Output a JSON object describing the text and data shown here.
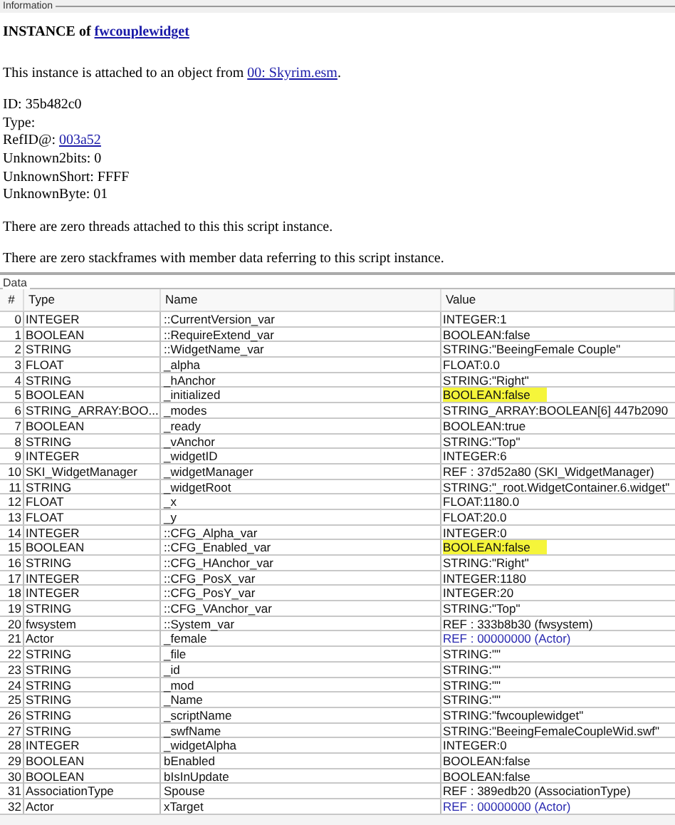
{
  "info_group": {
    "label": "Information",
    "heading_prefix": "INSTANCE of",
    "heading_link": "fwcouplewidget",
    "attached_text": "This instance is attached to an object from",
    "attached_link": "00: Skyrim.esm",
    "attached_suffix": ".",
    "fields": [
      {
        "label": "ID:",
        "value": "35b482c0"
      },
      {
        "label": "Type:"
      },
      {
        "label": "RefID@:",
        "link": "003a52"
      },
      {
        "label": "Unknown2bits:",
        "value": "0"
      },
      {
        "label": "UnknownShort:",
        "value": "FFFF"
      },
      {
        "label": "UnknownByte:",
        "value": "01"
      }
    ],
    "notes": [
      "There are zero threads attached to this this script instance.",
      "There are zero stackframes with member data referring to this script instance."
    ]
  },
  "data_group": {
    "label": "Data",
    "columns": [
      "#",
      "Type",
      "Name",
      "Value"
    ],
    "rows": [
      {
        "index": "0",
        "type": "INTEGER",
        "name": "::CurrentVersion_var",
        "value": "INTEGER:1",
        "highlighted": false,
        "kind": "plain"
      },
      {
        "index": "1",
        "type": "BOOLEAN",
        "name": "::RequireExtend_var",
        "value": "BOOLEAN:false",
        "highlighted": false,
        "kind": "plain"
      },
      {
        "index": "2",
        "type": "STRING",
        "name": "::WidgetName_var",
        "value": "STRING:\"BeeingFemale Couple\"",
        "highlighted": false,
        "kind": "plain"
      },
      {
        "index": "3",
        "type": "FLOAT",
        "name": "_alpha",
        "value": "FLOAT:0.0",
        "highlighted": false,
        "kind": "plain"
      },
      {
        "index": "4",
        "type": "STRING",
        "name": "_hAnchor",
        "value": "STRING:\"Right\"",
        "highlighted": false,
        "kind": "plain"
      },
      {
        "index": "5",
        "type": "BOOLEAN",
        "name": "_initialized",
        "value": "BOOLEAN:false",
        "highlighted": true,
        "kind": "plain"
      },
      {
        "index": "6",
        "type": "STRING_ARRAY:BOO...",
        "name": "_modes",
        "value": "STRING_ARRAY:BOOLEAN[6] 447b2090",
        "highlighted": false,
        "kind": "plain"
      },
      {
        "index": "7",
        "type": "BOOLEAN",
        "name": "_ready",
        "value": "BOOLEAN:true",
        "highlighted": false,
        "kind": "plain"
      },
      {
        "index": "8",
        "type": "STRING",
        "name": "_vAnchor",
        "value": "STRING:\"Top\"",
        "highlighted": false,
        "kind": "plain"
      },
      {
        "index": "9",
        "type": "INTEGER",
        "name": "_widgetID",
        "value": "INTEGER:6",
        "highlighted": false,
        "kind": "plain"
      },
      {
        "index": "10",
        "type": "SKI_WidgetManager",
        "name": "_widgetManager",
        "value": "REF : 37d52a80 (SKI_WidgetManager)",
        "highlighted": false,
        "kind": "plain"
      },
      {
        "index": "11",
        "type": "STRING",
        "name": "_widgetRoot",
        "value": "STRING:\"_root.WidgetContainer.6.widget\"",
        "highlighted": false,
        "kind": "plain"
      },
      {
        "index": "12",
        "type": "FLOAT",
        "name": "_x",
        "value": "FLOAT:1180.0",
        "highlighted": false,
        "kind": "plain"
      },
      {
        "index": "13",
        "type": "FLOAT",
        "name": "_y",
        "value": "FLOAT:20.0",
        "highlighted": false,
        "kind": "plain"
      },
      {
        "index": "14",
        "type": "INTEGER",
        "name": "::CFG_Alpha_var",
        "value": "INTEGER:0",
        "highlighted": false,
        "kind": "plain"
      },
      {
        "index": "15",
        "type": "BOOLEAN",
        "name": "::CFG_Enabled_var",
        "value": "BOOLEAN:false",
        "highlighted": true,
        "kind": "plain"
      },
      {
        "index": "16",
        "type": "STRING",
        "name": "::CFG_HAnchor_var",
        "value": "STRING:\"Right\"",
        "highlighted": false,
        "kind": "plain"
      },
      {
        "index": "17",
        "type": "INTEGER",
        "name": "::CFG_PosX_var",
        "value": "INTEGER:1180",
        "highlighted": false,
        "kind": "plain"
      },
      {
        "index": "18",
        "type": "INTEGER",
        "name": "::CFG_PosY_var",
        "value": "INTEGER:20",
        "highlighted": false,
        "kind": "plain"
      },
      {
        "index": "19",
        "type": "STRING",
        "name": "::CFG_VAnchor_var",
        "value": "STRING:\"Top\"",
        "highlighted": false,
        "kind": "plain"
      },
      {
        "index": "20",
        "type": "fwsystem",
        "name": "::System_var",
        "value": "REF : 333b8b30 (fwsystem)",
        "highlighted": false,
        "kind": "plain"
      },
      {
        "index": "21",
        "type": "Actor",
        "name": "_female",
        "value": "REF : 00000000 (Actor)",
        "highlighted": false,
        "kind": "null_ref"
      },
      {
        "index": "22",
        "type": "STRING",
        "name": "_file",
        "value": "STRING:\"\"",
        "highlighted": false,
        "kind": "plain"
      },
      {
        "index": "23",
        "type": "STRING",
        "name": "_id",
        "value": "STRING:\"\"",
        "highlighted": false,
        "kind": "plain"
      },
      {
        "index": "24",
        "type": "STRING",
        "name": "_mod",
        "value": "STRING:\"\"",
        "highlighted": false,
        "kind": "plain"
      },
      {
        "index": "25",
        "type": "STRING",
        "name": "_Name",
        "value": "STRING:\"\"",
        "highlighted": false,
        "kind": "plain"
      },
      {
        "index": "26",
        "type": "STRING",
        "name": "_scriptName",
        "value": "STRING:\"fwcouplewidget\"",
        "highlighted": false,
        "kind": "plain"
      },
      {
        "index": "27",
        "type": "STRING",
        "name": "_swfName",
        "value": "STRING:\"BeeingFemaleCoupleWid.swf\"",
        "highlighted": false,
        "kind": "plain"
      },
      {
        "index": "28",
        "type": "INTEGER",
        "name": "_widgetAlpha",
        "value": "INTEGER:0",
        "highlighted": false,
        "kind": "plain"
      },
      {
        "index": "29",
        "type": "BOOLEAN",
        "name": "bEnabled",
        "value": "BOOLEAN:false",
        "highlighted": false,
        "kind": "plain"
      },
      {
        "index": "30",
        "type": "BOOLEAN",
        "name": "bIsInUpdate",
        "value": "BOOLEAN:false",
        "highlighted": false,
        "kind": "plain"
      },
      {
        "index": "31",
        "type": "AssociationType",
        "name": "Spouse",
        "value": "REF : 389edb20 (AssociationType)",
        "highlighted": false,
        "kind": "plain"
      },
      {
        "index": "32",
        "type": "Actor",
        "name": "xTarget",
        "value": "REF : 00000000 (Actor)",
        "highlighted": false,
        "kind": "null_ref"
      }
    ]
  }
}
